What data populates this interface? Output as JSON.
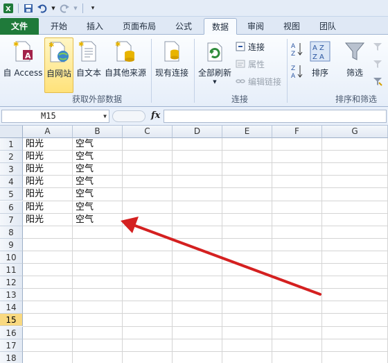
{
  "tabs": [
    "文件",
    "开始",
    "插入",
    "页面布局",
    "公式",
    "数据",
    "审阅",
    "视图",
    "团队"
  ],
  "active_tab": "数据",
  "ribbon": {
    "get_external": {
      "access": "自 Access",
      "web": "自网站",
      "text": "自文本",
      "other": "自其他来源",
      "existing": "现有连接",
      "group_label": "获取外部数据"
    },
    "connections": {
      "refresh_all": "全部刷新",
      "connections": "连接",
      "properties": "属性",
      "edit_links": "编辑链接",
      "group_label": "连接"
    },
    "sort_filter": {
      "sort": "排序",
      "filter": "筛选",
      "group_label": "排序和筛选"
    }
  },
  "formula_bar": {
    "name_box": "M15",
    "fx_label": "fx"
  },
  "columns": [
    "A",
    "B",
    "C",
    "D",
    "E",
    "F",
    "G"
  ],
  "rows": [
    "1",
    "2",
    "3",
    "4",
    "5",
    "6",
    "7",
    "8",
    "9",
    "10",
    "11",
    "12",
    "13",
    "14",
    "15",
    "16",
    "17",
    "18"
  ],
  "selected_row": "15",
  "cells": [
    [
      "阳光",
      "空气"
    ],
    [
      "阳光",
      "空气"
    ],
    [
      "阳光",
      "空气"
    ],
    [
      "阳光",
      "空气"
    ],
    [
      "阳光",
      "空气"
    ],
    [
      "阳光",
      "空气"
    ],
    [
      "阳光",
      "空气"
    ]
  ],
  "colors": {
    "file_tab": "#1f7a3a",
    "arrow": "#d42020",
    "selected_row_header": "#f9d980"
  }
}
